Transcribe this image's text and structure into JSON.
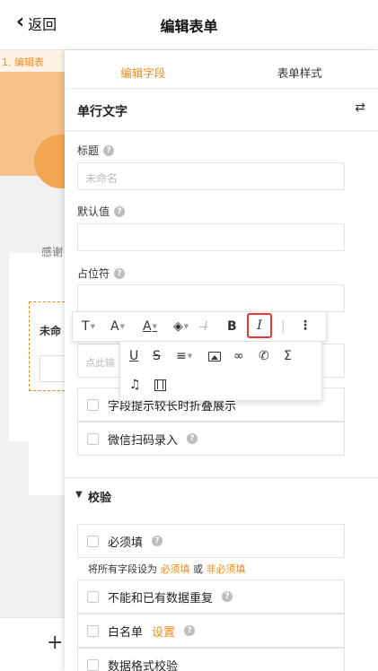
{
  "header": {
    "back_label": "返回",
    "title": "编辑表单"
  },
  "background": {
    "tab_label": "1. 编辑表",
    "text_fragment_1": "感谢",
    "text_fragment_2": "未命",
    "add_label": "+"
  },
  "panel": {
    "tabs": [
      {
        "label": "编辑字段",
        "active": true
      },
      {
        "label": "表单样式",
        "active": false
      }
    ],
    "field_type": "单行文字",
    "swap_icon": "⇄",
    "fields": {
      "title": {
        "label": "标题",
        "placeholder": "未命名"
      },
      "default": {
        "label": "默认值",
        "value": ""
      },
      "placeholder": {
        "label": "占位符",
        "value": ""
      }
    },
    "toolbar": {
      "row1": [
        "T",
        "A",
        "A",
        "paint-bucket",
        "clear-format",
        "B",
        "I",
        "more"
      ],
      "row2": [
        "U",
        "S",
        "align",
        "image",
        "link",
        "phone",
        "Σ"
      ],
      "row3": [
        "music",
        "video"
      ],
      "active_tool": "I"
    },
    "rich_text_placeholder": "点此输",
    "options": {
      "collapse": "字段提示较长时折叠展示",
      "wechat_scan": "微信扫码录入"
    },
    "validation": {
      "section_label": "校验",
      "required": "必须填",
      "hint_prefix": "将所有字段设为",
      "hint_required": "必须填",
      "hint_or": "或",
      "hint_optional": "非必须填",
      "no_duplicate": "不能和已有数据重复",
      "whitelist": "白名单",
      "whitelist_set": "设置",
      "format_check": "数据格式校验"
    }
  },
  "colors": {
    "accent": "#f08a1b",
    "highlight_border": "#e53935"
  }
}
